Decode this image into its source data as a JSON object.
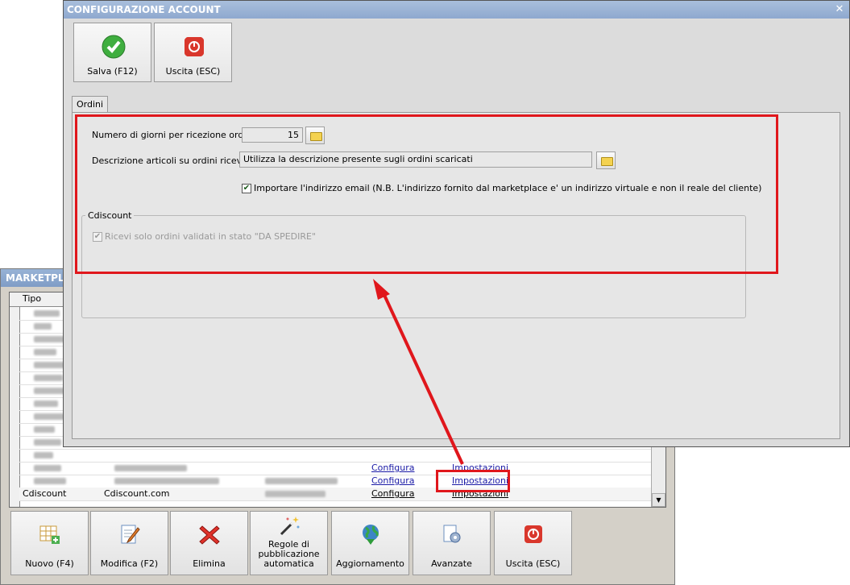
{
  "dialog": {
    "title": "CONFIGURAZIONE ACCOUNT",
    "close": "✕",
    "buttons": [
      {
        "label": "Salva (F12)",
        "icon": "checkmark-icon"
      },
      {
        "label": "Uscita (ESC)",
        "icon": "power-icon"
      }
    ],
    "tab": "Ordini",
    "fields": {
      "days_label": "Numero di giorni per ricezione ordini :",
      "days_value": "15",
      "desc_label": "Descrizione articoli  su ordini ricevuti :",
      "desc_value": "Utilizza la descrizione presente sugli ordini scaricati",
      "import_email_label": "Importare l'indirizzo email (N.B. L'indirizzo fornito dal marketplace e' un indirizzo virtuale e non il reale del cliente)",
      "import_email_checked": true
    },
    "group": {
      "title": "Cdiscount",
      "check_label": "Ricevi solo ordini validati in stato \"DA SPEDIRE\"",
      "check_checked": true
    }
  },
  "background": {
    "title": "MARKETPLA",
    "column_tipo": "Tipo",
    "rows": [
      {
        "c4": "Configura",
        "c5": "Impostazioni"
      },
      {
        "c4": "Configura",
        "c5": "Impostazioni"
      },
      {
        "c1": "Cdiscount",
        "c2": "Cdiscount.com",
        "c4": "Configura",
        "c5": "Impostazioni"
      }
    ],
    "toolbar": [
      {
        "label": "Nuovo (F4)",
        "icon": "new-grid-icon"
      },
      {
        "label": "Modifica (F2)",
        "icon": "edit-document-icon"
      },
      {
        "label": "Elimina",
        "icon": "delete-x-icon"
      },
      {
        "label": "Regole di pubblicazione automatica",
        "icon": "magic-wand-icon"
      },
      {
        "label": "Aggiornamento",
        "icon": "globe-refresh-icon"
      },
      {
        "label": "Avanzate",
        "icon": "gear-document-icon"
      },
      {
        "label": "Uscita (ESC)",
        "icon": "power-icon"
      }
    ],
    "scroll_down": "▼",
    "scroll_up": "▲"
  },
  "colors": {
    "highlight": "#e0171c",
    "title_bar": "#8ea8cf"
  }
}
